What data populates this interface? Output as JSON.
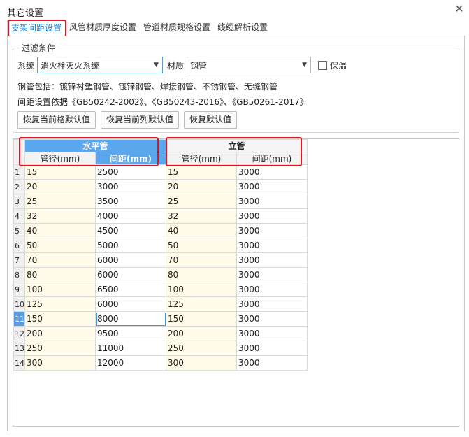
{
  "window": {
    "title": "其它设置",
    "close_glyph": "✕"
  },
  "tabs": [
    {
      "label": "支架间距设置",
      "active": true
    },
    {
      "label": "风管材质厚度设置",
      "active": false
    },
    {
      "label": "管道材质规格设置",
      "active": false
    },
    {
      "label": "线缆解析设置",
      "active": false
    }
  ],
  "filter": {
    "legend": "过滤条件",
    "system_label": "系统",
    "system_value": "消火栓灭火系统",
    "material_label": "材质",
    "material_value": "钢管",
    "insulation_label": "保温",
    "insulation_checked": false,
    "info_line1": "钢管包括：镀锌衬塑钢管、镀锌钢管、焊接钢管、不锈钢管、无缝钢管",
    "info_line2": "间距设置依据《GB50242-2002》、《GB50243-2016》、《GB50261-2017》",
    "buttons": {
      "restore_row": "恢复当前格默认值",
      "restore_col": "恢复当前列默认值",
      "restore_all": "恢复默认值"
    }
  },
  "grid": {
    "group_horizontal": "水平管",
    "group_vertical": "立管",
    "col_h_dia": "管径(mm)",
    "col_h_spacing": "间距(mm)",
    "col_v_dia": "管径(mm)",
    "col_v_spacing": "间距(mm)",
    "selected_row": 11,
    "rows": [
      {
        "n": "1",
        "h_dia": "15",
        "h_sp": "2500",
        "v_dia": "15",
        "v_sp": "3000"
      },
      {
        "n": "2",
        "h_dia": "20",
        "h_sp": "3000",
        "v_dia": "20",
        "v_sp": "3000"
      },
      {
        "n": "3",
        "h_dia": "25",
        "h_sp": "3500",
        "v_dia": "25",
        "v_sp": "3000"
      },
      {
        "n": "4",
        "h_dia": "32",
        "h_sp": "4000",
        "v_dia": "32",
        "v_sp": "3000"
      },
      {
        "n": "5",
        "h_dia": "40",
        "h_sp": "4500",
        "v_dia": "40",
        "v_sp": "3000"
      },
      {
        "n": "6",
        "h_dia": "50",
        "h_sp": "5000",
        "v_dia": "50",
        "v_sp": "3000"
      },
      {
        "n": "7",
        "h_dia": "70",
        "h_sp": "6000",
        "v_dia": "70",
        "v_sp": "3000"
      },
      {
        "n": "8",
        "h_dia": "80",
        "h_sp": "6000",
        "v_dia": "80",
        "v_sp": "3000"
      },
      {
        "n": "9",
        "h_dia": "100",
        "h_sp": "6500",
        "v_dia": "100",
        "v_sp": "3000"
      },
      {
        "n": "10",
        "h_dia": "125",
        "h_sp": "6000",
        "v_dia": "125",
        "v_sp": "3000"
      },
      {
        "n": "11",
        "h_dia": "150",
        "h_sp": "8000",
        "v_dia": "150",
        "v_sp": "3000"
      },
      {
        "n": "12",
        "h_dia": "200",
        "h_sp": "9500",
        "v_dia": "200",
        "v_sp": "3000"
      },
      {
        "n": "13",
        "h_dia": "250",
        "h_sp": "11000",
        "v_dia": "250",
        "v_sp": "3000"
      },
      {
        "n": "14",
        "h_dia": "300",
        "h_sp": "12000",
        "v_dia": "300",
        "v_sp": "3000"
      }
    ]
  },
  "colors": {
    "accent": "#1a7fd6",
    "header_blue": "#5ba7ee",
    "highlight_red": "#e8121e",
    "cell_yellow": "#fffbe8"
  }
}
